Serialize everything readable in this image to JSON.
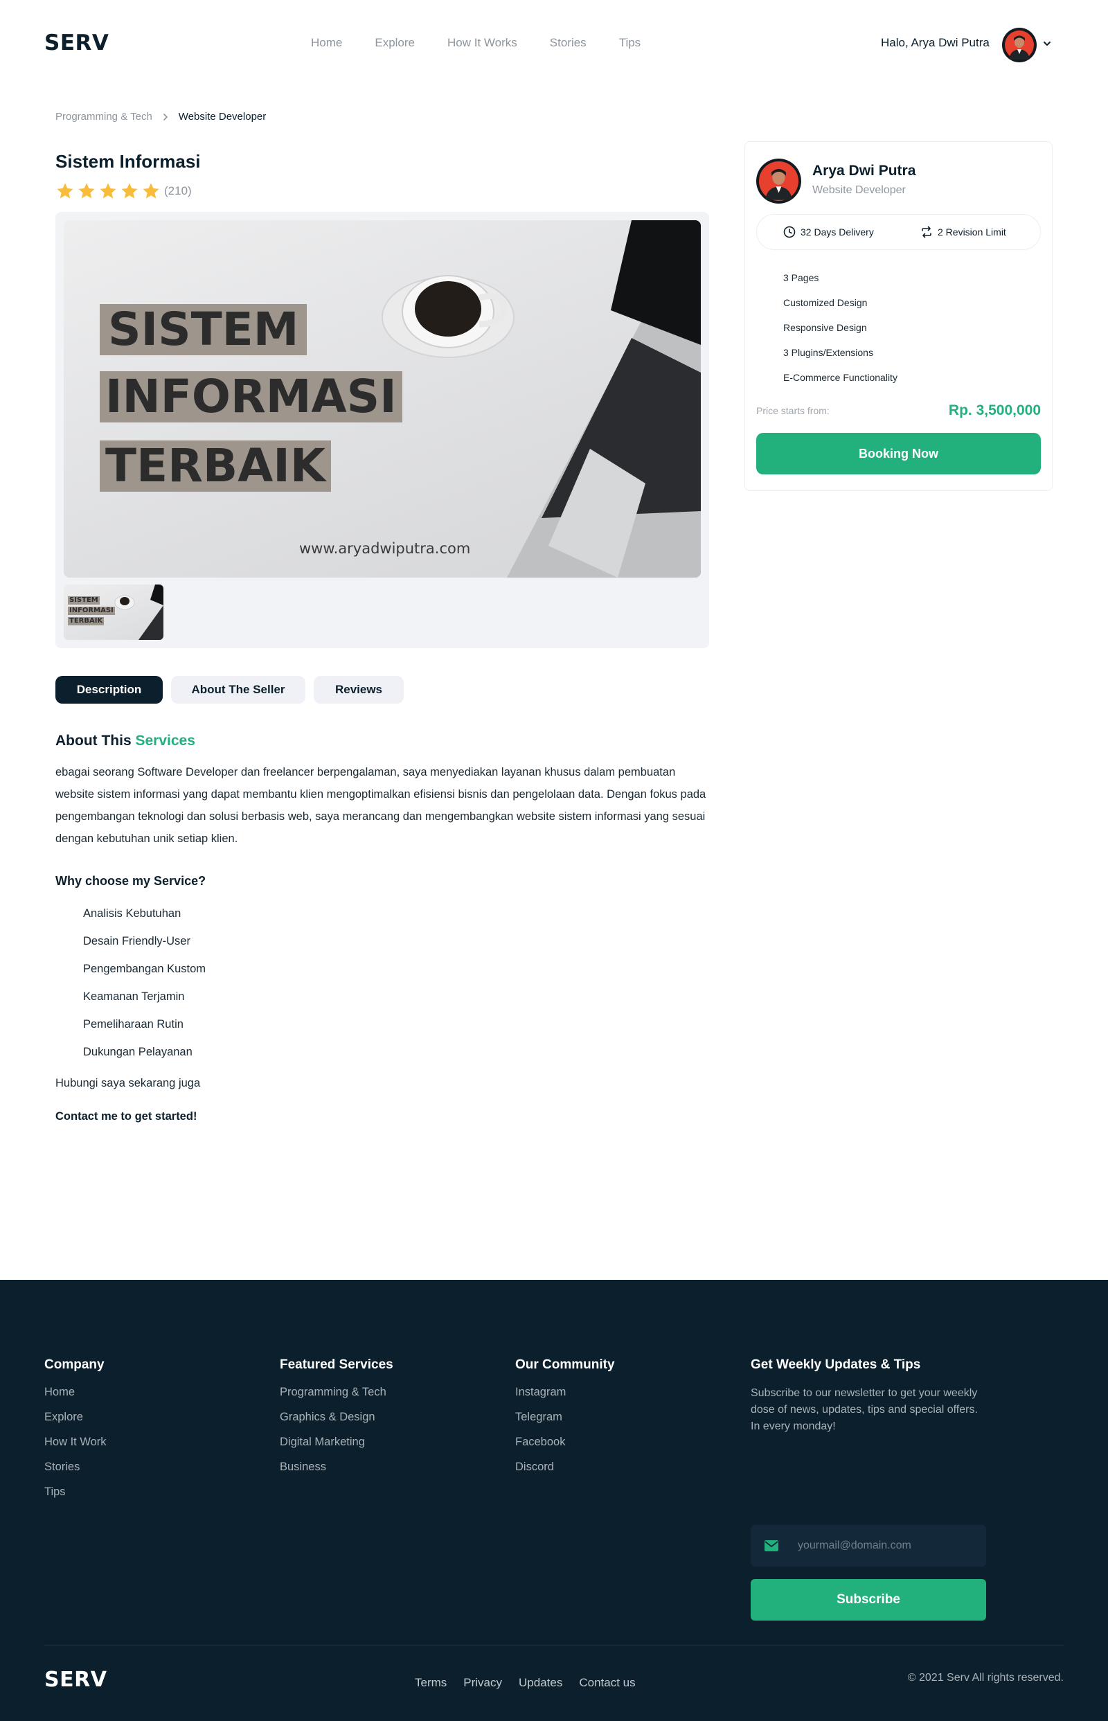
{
  "header": {
    "logo": "SERV",
    "nav": [
      "Home",
      "Explore",
      "How It Works",
      "Stories",
      "Tips"
    ],
    "greeting": "Halo, Arya Dwi Putra"
  },
  "breadcrumb": [
    "Programming & Tech",
    "Website Developer"
  ],
  "service": {
    "title": "Sistem Informasi",
    "stars": 5,
    "rating_count": "(210)",
    "image_lines": [
      "SISTEM",
      "INFORMASI",
      "TERBAIK"
    ],
    "image_website": "www.aryadwiputra.com"
  },
  "tabs": [
    "Description",
    "About The Seller",
    "Reviews"
  ],
  "about": {
    "title_prefix": "About This",
    "title_accent": "Services",
    "body": "ebagai seorang Software Developer dan freelancer berpengalaman, saya menyediakan layanan khusus dalam pembuatan website sistem informasi yang dapat membantu klien mengoptimalkan efisiensi bisnis dan pengelolaan data. Dengan fokus pada pengembangan teknologi dan solusi berbasis web, saya merancang dan mengembangkan website sistem informasi yang sesuai dengan kebutuhan unik setiap klien.",
    "why_title": "Why choose my Service?",
    "why_items": [
      "Analisis Kebutuhan",
      "Desain Friendly-User",
      "Pengembangan Kustom",
      "Keamanan Terjamin",
      "Pemeliharaan Rutin",
      "Dukungan Pelayanan"
    ],
    "hubungi": "Hubungi saya sekarang juga",
    "contact": "Contact me to get started!"
  },
  "seller_card": {
    "name": "Arya Dwi Putra",
    "role": "Website Developer",
    "delivery": "32 Days Delivery",
    "revision": "2 Revision Limit",
    "features": [
      "3 Pages",
      "Customized Design",
      "Responsive Design",
      "3 Plugins/Extensions",
      "E-Commerce Functionality"
    ],
    "price_label": "Price starts from:",
    "price": "Rp. 3,500,000",
    "book_label": "Booking Now"
  },
  "footer": {
    "company": {
      "title": "Company",
      "links": [
        "Home",
        "Explore",
        "How It Work",
        "Stories",
        "Tips"
      ]
    },
    "featured": {
      "title": "Featured Services",
      "links": [
        "Programming & Tech",
        "Graphics & Design",
        "Digital Marketing",
        "Business"
      ]
    },
    "community": {
      "title": "Our Community",
      "links": [
        "Instagram",
        "Telegram",
        "Facebook",
        "Discord"
      ]
    },
    "newsletter": {
      "title": "Get Weekly Updates & Tips",
      "text": "Subscribe to our newsletter to get your weekly dose of news, updates, tips and special offers. In every monday!",
      "email_placeholder": "yourmail@domain.com",
      "subscribe_label": "Subscribe"
    },
    "logo": "SERV",
    "bottom_links": [
      "Terms",
      "Privacy",
      "Updates",
      "Contact us"
    ],
    "copyright": "© 2021 Serv All rights reserved."
  },
  "colors": {
    "primary": "#22b07d",
    "dark": "#0b1f2c",
    "muted": "#8e959d",
    "star": "#f9bc3a"
  },
  "icons": [
    "avatar",
    "chevron-down-icon",
    "star-icon",
    "clock-icon",
    "refresh-icon",
    "mail-icon",
    "chevron-right-icon"
  ]
}
